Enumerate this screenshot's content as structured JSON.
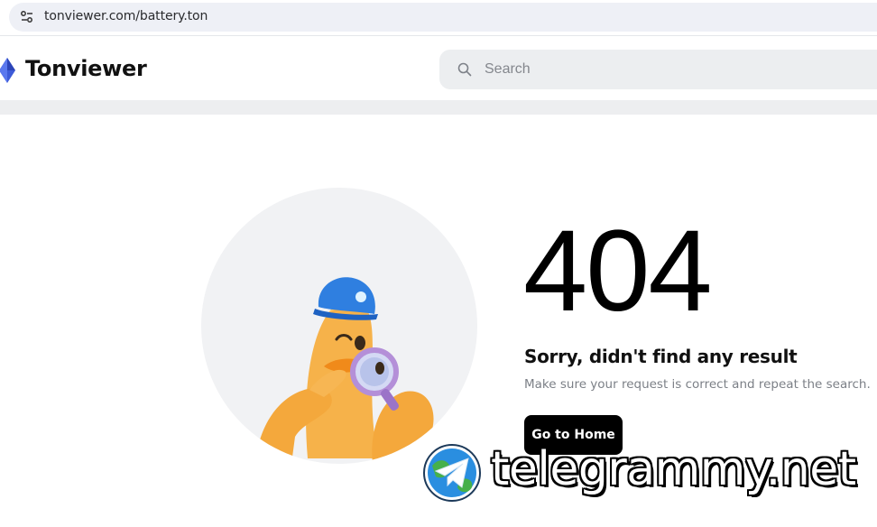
{
  "browser": {
    "url": "tonviewer.com/battery.ton",
    "site_info_icon": "tune-icon"
  },
  "header": {
    "logo_text": "Tonviewer",
    "logo_icon": "ton-diamond-icon",
    "search": {
      "placeholder": "Search",
      "value": ""
    }
  },
  "error": {
    "code": "404",
    "title": "Sorry, didn't find any result",
    "subtitle": "Make sure your request is correct and repeat the search.",
    "button_label": "Go to Home",
    "illustration": "duck-with-magnifier"
  },
  "watermark": {
    "text": "telegrammy.net",
    "icon": "telegram-globe-icon"
  },
  "colors": {
    "accent": "#3a5bd9",
    "button_bg": "#000000",
    "search_bg": "#eceef0",
    "subtitle": "#7c8087"
  }
}
